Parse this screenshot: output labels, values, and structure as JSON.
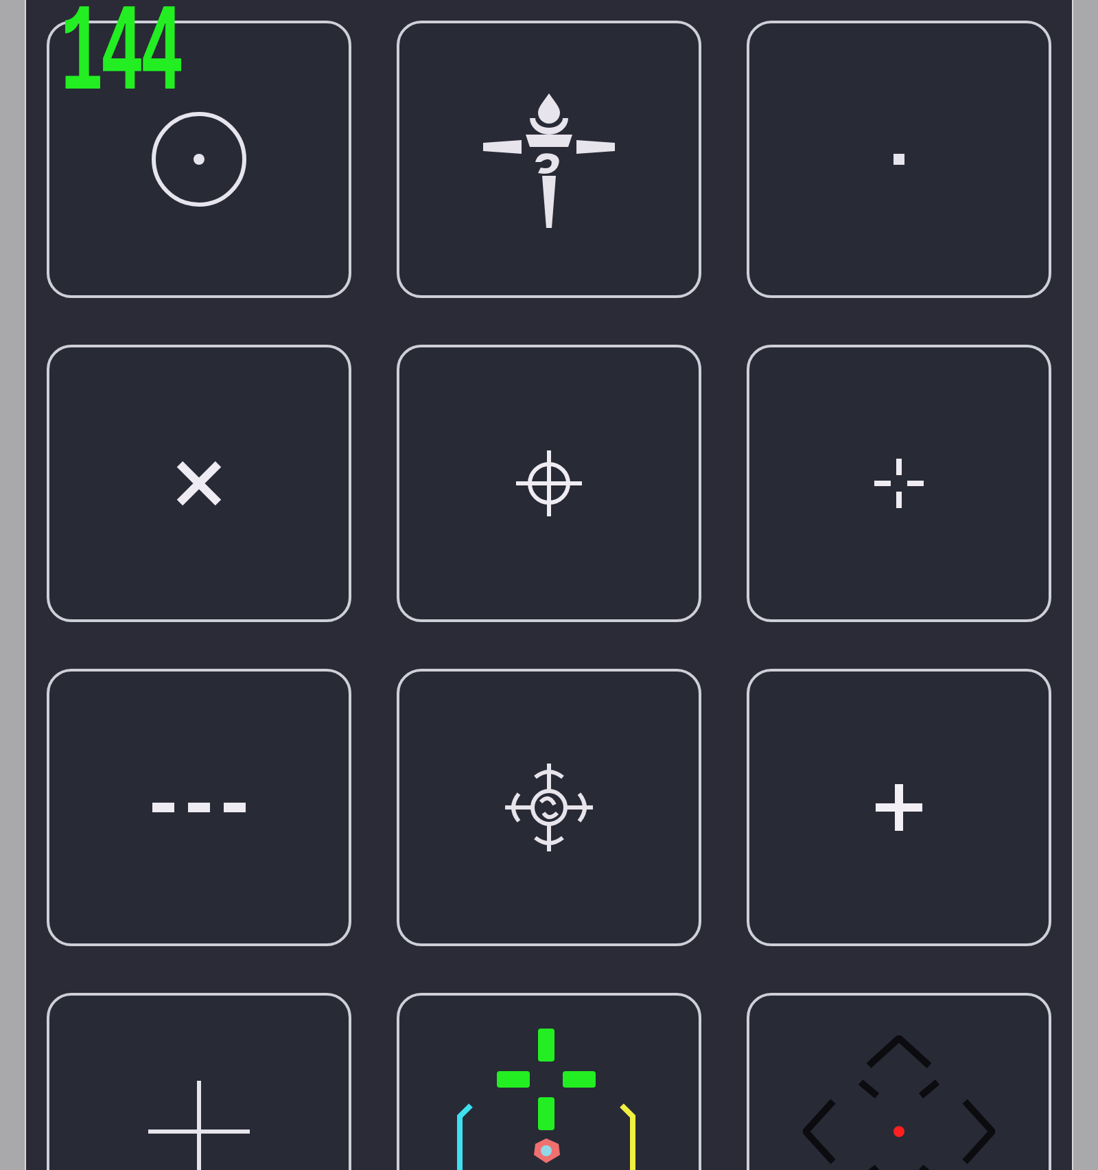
{
  "fps_counter": "144",
  "crosshairs": [
    {
      "kind": "circle-dot"
    },
    {
      "kind": "ornate-cross"
    },
    {
      "kind": "dot"
    },
    {
      "kind": "x-cross"
    },
    {
      "kind": "scope-cross"
    },
    {
      "kind": "split-cross"
    },
    {
      "kind": "dash-line"
    },
    {
      "kind": "ornate-star"
    },
    {
      "kind": "plus"
    },
    {
      "kind": "thin-cross"
    },
    {
      "kind": "neon-bracket"
    },
    {
      "kind": "diamond-corners"
    }
  ]
}
